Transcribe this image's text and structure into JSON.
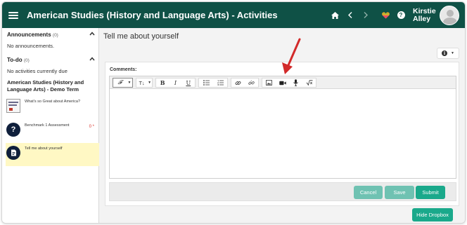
{
  "header": {
    "title": "American Studies (History and Language Arts) - Activities",
    "user_name": "Kirstie Alley",
    "icons": [
      "home-icon",
      "chevron-left-icon",
      "chevron-right-icon",
      "heart-icon",
      "help-icon"
    ]
  },
  "sidebar": {
    "announcements": {
      "label": "Announcements",
      "count": "(0)",
      "empty_text": "No announcements."
    },
    "todo": {
      "label": "To-do",
      "count": "(0)",
      "empty_text": "No activities currently due"
    },
    "course_title": "American Studies (History and Language Arts) - Demo Term",
    "activities": [
      {
        "label": "What's so Great about America?",
        "icon": "project-template-icon",
        "score": ""
      },
      {
        "label": "Benchmark 1 Assessment",
        "icon": "question-icon",
        "score": "0 *"
      },
      {
        "label": "Tell me about yourself",
        "icon": "document-icon",
        "score": "",
        "selected": true
      }
    ]
  },
  "main": {
    "title": "Tell me about yourself",
    "comments_label": "Comments:",
    "toolbar": {
      "font_label": "𝓕",
      "size_label": "T↓",
      "bold": "B",
      "italic": "I",
      "underline": "U"
    },
    "buttons": {
      "cancel": "Cancel",
      "save": "Save",
      "submit": "Submit"
    },
    "hide_dropbox": "Hide Dropbox"
  },
  "colors": {
    "header_bg": "#0f5146",
    "accent": "#1aa98b",
    "accent_disabled": "#6fc2b2",
    "selected_item_bg": "#fff8c4",
    "annotation_arrow": "#d22a2a"
  }
}
